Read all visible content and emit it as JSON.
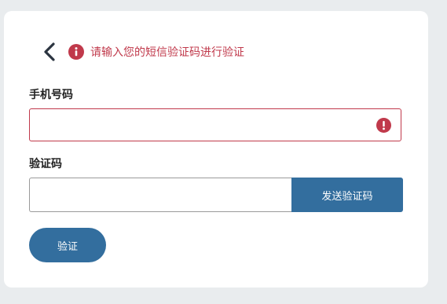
{
  "header": {
    "back_icon": "chevron-left-icon",
    "error_icon": "error-circle-icon",
    "error_message": "请输入您的短信验证码进行验证"
  },
  "form": {
    "phone_label": "手机号码",
    "phone_value": "",
    "phone_error_icon": "error-circle-icon",
    "code_label": "验证码",
    "code_value": "",
    "send_code_label": "发送验证码",
    "verify_label": "验证"
  },
  "colors": {
    "background": "#e9ecee",
    "card": "#ffffff",
    "error": "#c0394b",
    "primary": "#336e9e"
  }
}
